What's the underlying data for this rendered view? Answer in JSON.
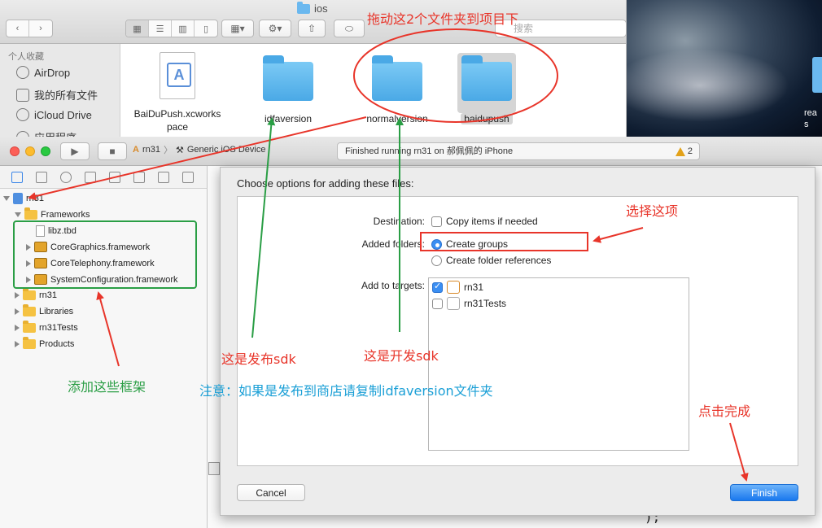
{
  "finder": {
    "title": "ios",
    "search_placeholder": "搜索",
    "sidebar": {
      "header": "个人收藏",
      "items": [
        {
          "label": "AirDrop",
          "icon": "airdrop-icon"
        },
        {
          "label": "我的所有文件",
          "icon": "all-files-icon"
        },
        {
          "label": "iCloud Drive",
          "icon": "cloud-icon"
        },
        {
          "label": "应用程序",
          "icon": "applications-icon"
        }
      ]
    },
    "files": [
      {
        "name": "BaiDuPush.xcworks pace",
        "line1": "BaiDuPush.xcworks",
        "line2": "pace",
        "kind": "xcworkspace"
      },
      {
        "name": "idfaversion",
        "kind": "folder"
      },
      {
        "name": "normalversion",
        "kind": "folder"
      },
      {
        "name": "baidupush",
        "kind": "folder",
        "selected": true
      }
    ]
  },
  "desktop": {
    "label_line1": "rea",
    "label_line2": "s"
  },
  "xcode": {
    "scheme": "rn31",
    "device": "Generic iOS Device",
    "status": "Finished running rn31 on 郝佩佩的 iPhone",
    "warning_count": "2",
    "navigator": {
      "project": "rn31",
      "frameworks_group": "Frameworks",
      "framework_items": [
        "libz.tbd",
        "CoreGraphics.framework",
        "CoreTelephony.framework",
        "SystemConfiguration.framework"
      ],
      "groups": [
        "rn31",
        "Libraries",
        "rn31Tests",
        "Products"
      ]
    },
    "code_fragment": ");"
  },
  "sheet": {
    "title": "Choose options for adding these files:",
    "destination_label": "Destination:",
    "copy_items_label": "Copy items if needed",
    "copy_items_checked": false,
    "added_folders_label": "Added folders:",
    "create_groups_label": "Create groups",
    "create_groups_selected": true,
    "create_refs_label": "Create folder references",
    "add_to_targets_label": "Add to targets:",
    "targets": [
      {
        "name": "rn31",
        "checked": true
      },
      {
        "name": "rn31Tests",
        "checked": false
      }
    ],
    "cancel_label": "Cancel",
    "finish_label": "Finish"
  },
  "annotations": {
    "drag_folders": "拖动这2个文件夹到项目下",
    "select_this": "选择这项",
    "release_sdk": "这是发布sdk",
    "dev_sdk": "这是开发sdk",
    "add_frameworks": "添加这些框架",
    "note": "注意：如果是发布到商店请复制idfaversion文件夹",
    "click_finish": "点击完成"
  },
  "colors": {
    "annotation_red": "#e8352a",
    "annotation_green": "#2a9e45",
    "annotation_cyan": "#1a9fd6",
    "accent_blue": "#1a78ee",
    "folder_blue": "#4aa9e6"
  }
}
